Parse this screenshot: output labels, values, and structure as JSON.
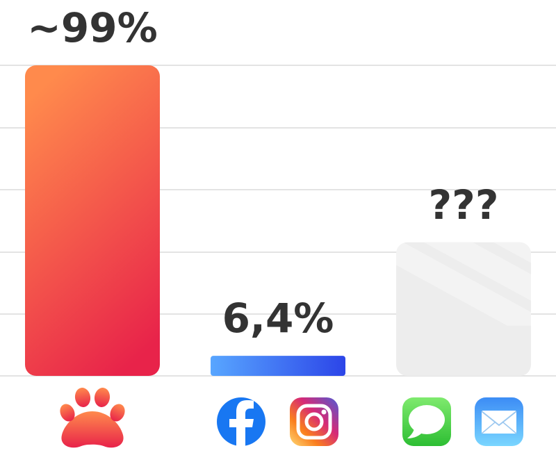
{
  "chart_data": {
    "type": "bar",
    "categories": [
      "paw-app",
      "social-media",
      "messaging"
    ],
    "values": [
      99,
      6.4,
      null
    ],
    "value_labels": [
      "~99%",
      "6,4%",
      "???"
    ],
    "ylim": [
      0,
      100
    ],
    "grid": true,
    "legend": "none",
    "category_icons": [
      [
        "paw-icon"
      ],
      [
        "facebook-icon",
        "instagram-icon"
      ],
      [
        "messages-icon",
        "mail-icon"
      ]
    ]
  },
  "colors": {
    "bar_1_top": "#FF8A4C",
    "bar_1_bottom": "#E8234A",
    "bar_2_left": "#58A6FF",
    "bar_2_right": "#2C45E8",
    "bar_3_fill": "#EDEDED",
    "grid": "#E3E3E3",
    "label": "#333333",
    "facebook": "#1877F2",
    "messages_green": "#4CD964",
    "mail_blue": "#3C8CF5"
  }
}
